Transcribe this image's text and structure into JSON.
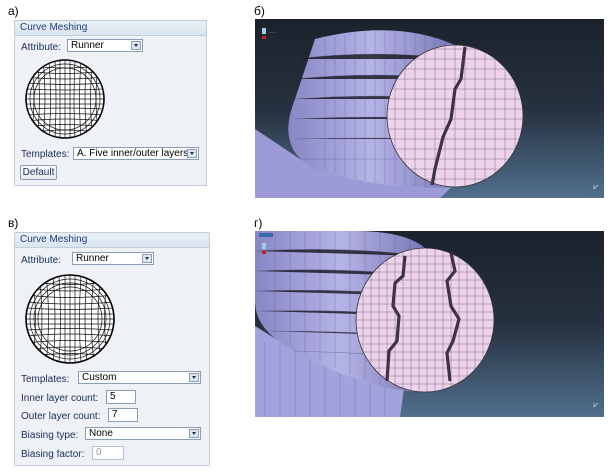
{
  "figure_labels": {
    "a": "а)",
    "b": "б)",
    "v": "в)",
    "g": "г)"
  },
  "panel_a": {
    "title": "Curve Meshing",
    "attribute_label": "Attribute:",
    "attribute_value": "Runner",
    "templates_label": "Templates:",
    "templates_value": "A. Five inner/outer layers",
    "default_button": "Default"
  },
  "panel_v": {
    "title": "Curve Meshing",
    "attribute_label": "Attribute:",
    "attribute_value": "Runner",
    "templates_label": "Templates:",
    "templates_value": "Custom",
    "inner_label": "Inner layer count:",
    "inner_value": "5",
    "outer_label": "Outer layer count:",
    "outer_value": "7",
    "biasing_type_label": "Biasing type:",
    "biasing_type_value": "None",
    "biasing_factor_label": "Biasing factor:",
    "biasing_factor_value": "0"
  },
  "colors": {
    "background_top": "#1d2530",
    "background_bottom": "#4a6580",
    "mesh_fill": "#e9cfe8",
    "tube_fill": "#a9a8de",
    "panel_bg": "#eef2f6",
    "label_blue": "#1a2c5a"
  }
}
